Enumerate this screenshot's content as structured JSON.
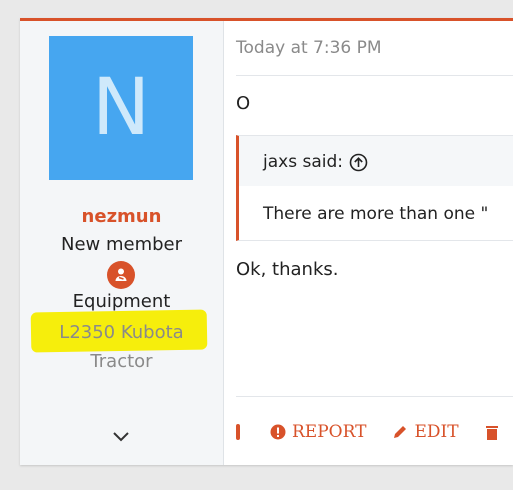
{
  "user": {
    "avatar_letter": "N",
    "name": "nezmun",
    "title": "New member",
    "extra_label": "Equipment",
    "extra_value_line1": "L2350 Kubota",
    "extra_value_line2": "Tractor"
  },
  "post": {
    "date": "Today at 7:36 PM",
    "first_line": "O",
    "quote": {
      "author": "jaxs said:",
      "text": "There are more than one \""
    },
    "reply": "Ok, thanks."
  },
  "actions": {
    "report": "REPORT",
    "edit": "EDIT"
  },
  "colors": {
    "accent": "#d8522a",
    "avatar_bg": "#46a6f0",
    "highlight": "#f6ee0c"
  }
}
